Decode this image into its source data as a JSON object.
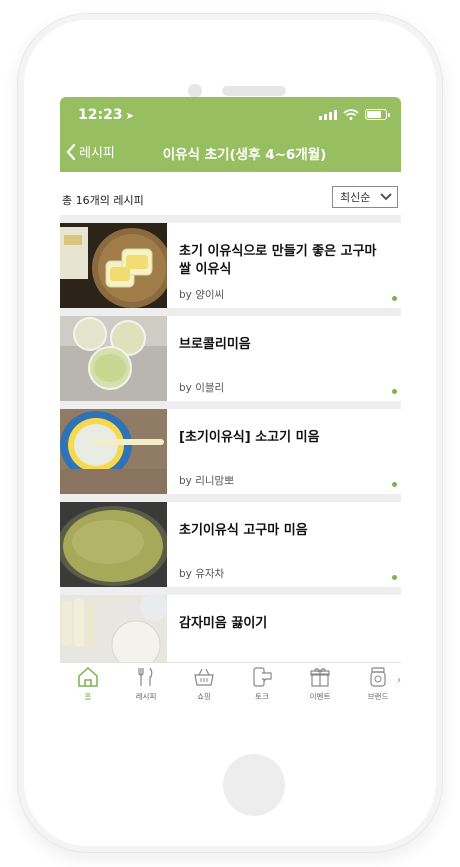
{
  "status": {
    "time": "12:23"
  },
  "nav": {
    "back_label": "레시피",
    "title": "이유식 초기(생후 4~6개월)"
  },
  "summary": {
    "count_text": "총 16개의 레시피",
    "sort_label": "최신순"
  },
  "recipes": [
    {
      "title": "초기 이유식으로 만들기 좋은 고구마 쌀 이유식",
      "author": "by 양이씨"
    },
    {
      "title": "브로콜리미음",
      "author": "by 이블리"
    },
    {
      "title": "[초기이유식] 소고기 미음",
      "author": "by 리니맘뽀"
    },
    {
      "title": "초기이유식 고구마 미음",
      "author": "by 유자차"
    },
    {
      "title": "감자미음 끓이기",
      "author": ""
    }
  ],
  "tabs": [
    {
      "label": "홈"
    },
    {
      "label": "레시피"
    },
    {
      "label": "쇼핑"
    },
    {
      "label": "토크"
    },
    {
      "label": "이벤트"
    },
    {
      "label": "브랜드"
    }
  ],
  "colors": {
    "brand_green": "#97bf62",
    "accent_green": "#7fb24a"
  }
}
